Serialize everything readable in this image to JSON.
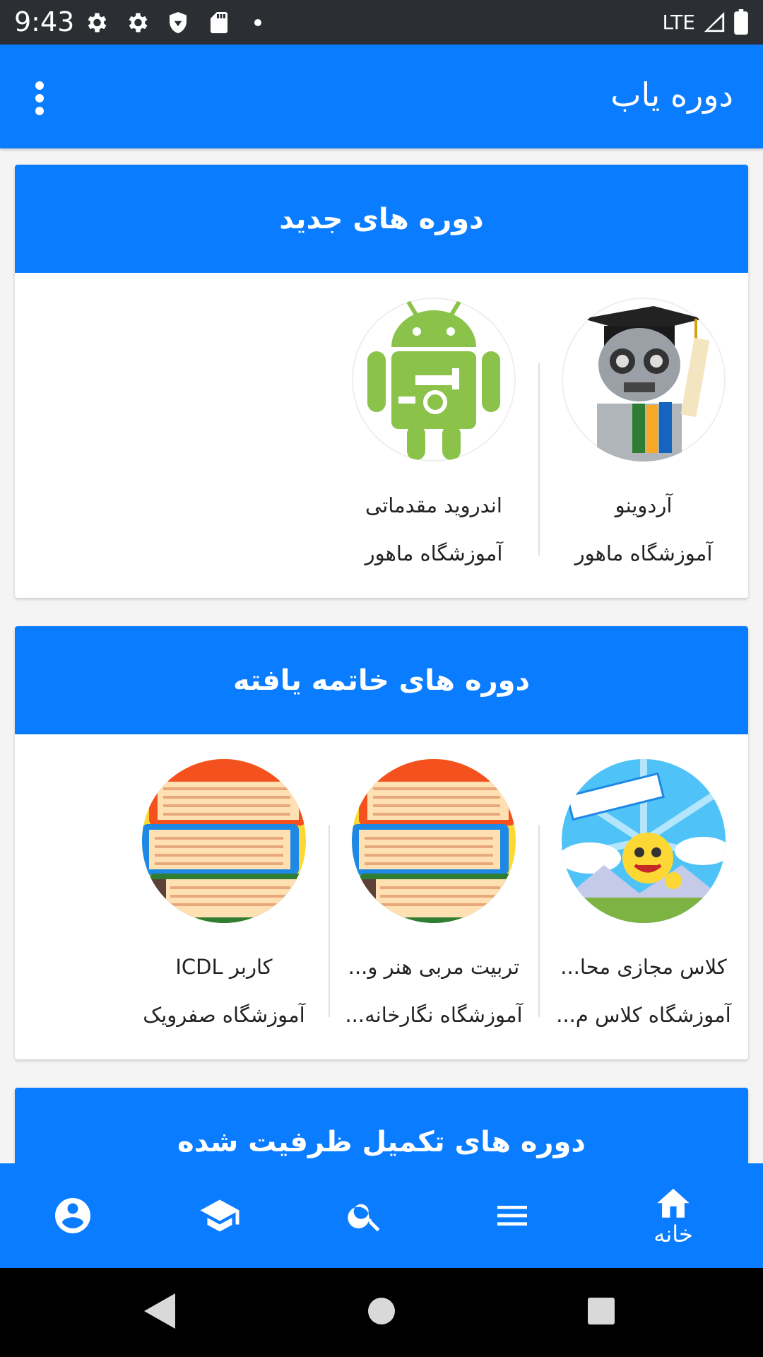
{
  "status_bar": {
    "time": "9:43",
    "network": "LTE"
  },
  "app_bar": {
    "title": "دوره یاب"
  },
  "sections": [
    {
      "title": "دوره های جدید",
      "items": [
        {
          "title": "آردوینو",
          "subtitle": "آموزشگاه ماهور",
          "image": "robot-graduate"
        },
        {
          "title": "اندروید مقدماتی",
          "subtitle": "آموزشگاه ماهور",
          "image": "android-robot"
        }
      ]
    },
    {
      "title": "دوره های خاتمه یافته",
      "items": [
        {
          "title": "کلاس مجازی محا...",
          "subtitle": "آموزشگاه کلاس م...",
          "image": "cartoon-station"
        },
        {
          "title": "تربیت مربی هنر و...",
          "subtitle": "آموزشگاه نگارخانه...",
          "image": "book-stack"
        },
        {
          "title": "کاربر ICDL",
          "subtitle": "آموزشگاه صفرویک",
          "image": "book-stack"
        }
      ]
    },
    {
      "title": "دوره های تکمیل ظرفیت شده"
    }
  ],
  "bottom_nav": {
    "home_label": "خانه",
    "items": [
      "home-icon",
      "menu-icon",
      "search-icon",
      "school-icon",
      "account-icon"
    ]
  },
  "colors": {
    "primary": "#0a7cff",
    "status_bar": "#2b2f33"
  }
}
